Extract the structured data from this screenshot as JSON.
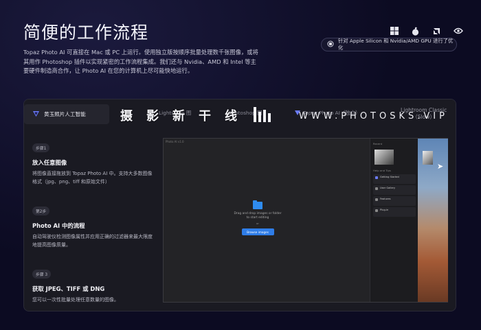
{
  "header": {
    "title": "简便的工作流程",
    "description": "Topaz Photo AI 可直接在 Mac 或 PC 上运行。使用独立版按顺序批量处理数千张图像，或将其用作 Photoshop 插件以实现紧密的工作流程集成。我们还与 Nvidia、AMD 和 Intel 等主要硬件制造商合作，让 Photo AI 在您的计算机上尽可能快地运行。"
  },
  "platforms": {
    "icons": [
      "windows-icon",
      "apple-icon",
      "amd-icon",
      "nvidia-icon"
    ],
    "gpu_note": "针对 Apple Silicon 和 Nvidia/AMD GPU 进行了优化"
  },
  "tabs": {
    "active": "黄玉照片人工智能",
    "lightroom_fragment": "Lightroom 图",
    "photoshop_fragment": "Photoshop 图",
    "topaz_tab": "Topaz Photo AI（独立）",
    "lightroom_classic_line1": "Lightroom Classic",
    "lightroom_classic_line2": "（Slow）"
  },
  "watermark": {
    "big_text": "摄影新干线",
    "url_text": "WWW.PHOTOSKS.VIP"
  },
  "steps": [
    {
      "badge": "步骤1",
      "title": "放入任意图像",
      "text": "将图像直接拖放到 Topaz Photo AI 中。支持大多数图像格式（jpg、png、tiff 和原始文件）"
    },
    {
      "badge": "第2步",
      "title": "Photo AI 中的流程",
      "text": "自动驾驶仪检测图像属性并应用正确的过滤器来最大限度地提高图像质量。"
    },
    {
      "badge": "步骤 3",
      "title": "获取 JPEG、TIFF 或 DNG",
      "text": "您可以一次性批量处理任意数量的图像。"
    }
  ],
  "app": {
    "window_title": "Photo AI v1.0",
    "drop_text": "Drag and drop images or folder to start editing",
    "or_text": "or",
    "browse_label": "Browse images",
    "recent_label": "Recent",
    "help_label": "Help and Tips",
    "help_items": [
      "Getting Started",
      "User Gallery",
      "Features",
      "Plug-in"
    ]
  },
  "colors": {
    "background": "#0c0b22",
    "card": "#1a1a22",
    "accent_blue": "#2f7de8"
  }
}
